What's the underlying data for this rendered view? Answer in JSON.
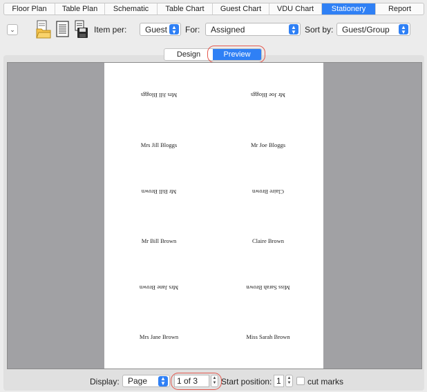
{
  "tabs": [
    {
      "label": "Floor Plan"
    },
    {
      "label": "Table Plan"
    },
    {
      "label": "Schematic"
    },
    {
      "label": "Table Chart"
    },
    {
      "label": "Guest Chart"
    },
    {
      "label": "VDU Chart"
    },
    {
      "label": "Stationery",
      "active": true
    },
    {
      "label": "Report"
    }
  ],
  "toolbar": {
    "item_per_label": "Item per:",
    "item_per_value": "Guest",
    "for_label": "For:",
    "for_value": "Assigned",
    "sort_by_label": "Sort by:",
    "sort_by_value": "Guest/Group"
  },
  "view_mode": {
    "design_label": "Design",
    "preview_label": "Preview",
    "selected": "Preview"
  },
  "cards": [
    {
      "left": "Mrs Jill Bloggs",
      "right": "Mr Joe Bloggs"
    },
    {
      "left": "Mr Bill Brown",
      "right": "Claire Brown"
    },
    {
      "left": "Mrs Jane Brown",
      "right": "Miss Sarah Brown"
    }
  ],
  "bottom": {
    "display_label": "Display:",
    "display_value": "Page",
    "page_indicator": "1 of 3",
    "start_position_label": "Start position:",
    "start_position_value": "1",
    "cut_marks_label": "cut marks",
    "cut_marks_checked": false
  },
  "colors": {
    "accent": "#2f80f5",
    "highlight": "#e4574c",
    "canvas": "#a1a1a4"
  }
}
